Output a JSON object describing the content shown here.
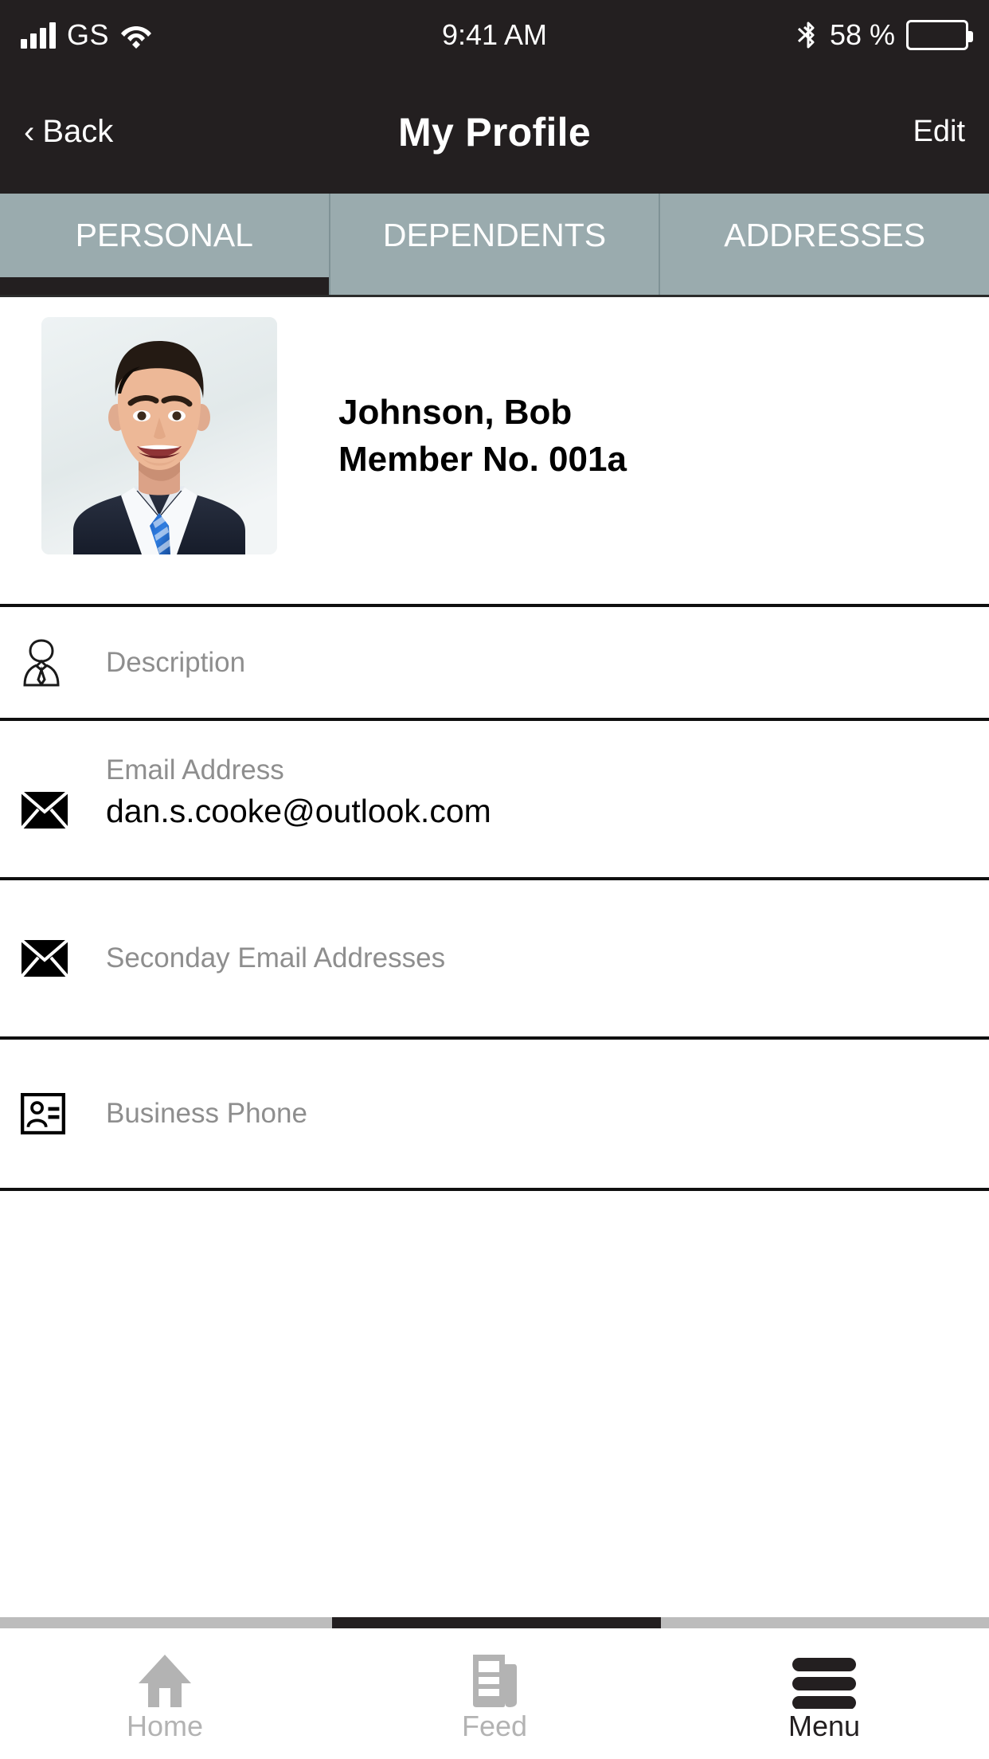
{
  "status_bar": {
    "carrier": "GS",
    "time": "9:41 AM",
    "battery_percent": "58 %",
    "signal_icon": "signal-bars-icon",
    "wifi_icon": "wifi-icon",
    "bluetooth_icon": "bluetooth-icon",
    "battery_icon": "battery-icon"
  },
  "nav_bar": {
    "back_label": "Back",
    "back_chevron": "‹",
    "title": "My Profile",
    "edit_label": "Edit"
  },
  "tabs": [
    {
      "label": "PERSONAL",
      "active": true
    },
    {
      "label": "DEPENDENTS",
      "active": false
    },
    {
      "label": "ADDRESSES",
      "active": false
    }
  ],
  "profile": {
    "avatar_alt": "profile-photo",
    "name": "Johnson, Bob",
    "member_no": "Member No. 001a"
  },
  "fields": [
    {
      "icon": "person-tie-icon",
      "label": "Description",
      "value": ""
    },
    {
      "icon": "envelope-icon",
      "label": "Email Address",
      "value": "dan.s.cooke@outlook.com"
    },
    {
      "icon": "envelope-icon",
      "label": "Seconday Email Addresses",
      "value": ""
    },
    {
      "icon": "contact-card-icon",
      "label": "Business Phone",
      "value": ""
    }
  ],
  "bottom_nav": [
    {
      "label": "Home",
      "icon": "home-icon",
      "active": false
    },
    {
      "label": "Feed",
      "icon": "newspaper-icon",
      "active": false
    },
    {
      "label": "Menu",
      "icon": "hamburger-icon",
      "active": true
    }
  ],
  "colors": {
    "nav_background": "#231f20",
    "tab_background": "#9aabae",
    "label_gray": "#8e8e8e",
    "inactive_gray": "#b3b3b3",
    "divider": "#0f0f0f"
  }
}
